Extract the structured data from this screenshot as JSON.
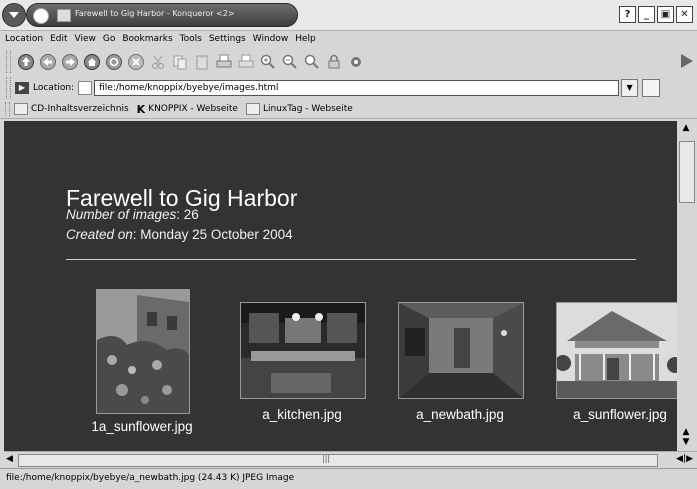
{
  "window": {
    "title": "Farewell to Gig Harbor - Konqueror <2>",
    "buttons": [
      "?",
      "_",
      "▣",
      "✕"
    ]
  },
  "menubar": [
    "Location",
    "Edit",
    "View",
    "Go",
    "Bookmarks",
    "Tools",
    "Settings",
    "Window",
    "Help"
  ],
  "toolbar": {
    "icons": [
      "up-icon",
      "back-icon",
      "forward-icon",
      "home-icon",
      "reload-icon",
      "stop-icon",
      "cut-icon",
      "copy-icon",
      "paste-icon",
      "print-icon",
      "print-frame-icon",
      "zoom-in-icon",
      "zoom-out-icon",
      "find-icon",
      "security-icon",
      "konqueror-icon"
    ]
  },
  "location": {
    "label": "Location:",
    "value": "file:/home/knoppix/byebye/images.html"
  },
  "bookmarks": [
    {
      "label": "CD-Inhaltsverzeichnis",
      "icon": "page-icon"
    },
    {
      "label": "KNOPPIX - Webseite",
      "icon": "knoppix-icon"
    },
    {
      "label": "LinuxTag - Webseite",
      "icon": "page-icon"
    }
  ],
  "page": {
    "title": "Farewell to Gig Harbor",
    "num_images_label": "Number of images",
    "num_images_value": ": 26",
    "created_label": "Created on",
    "created_value": ": Monday 25 October 2004",
    "thumbnails": [
      {
        "caption": "1a_sunflower.jpg",
        "subject": "sunflower-garden"
      },
      {
        "caption": "a_kitchen.jpg",
        "subject": "kitchen"
      },
      {
        "caption": "a_newbath.jpg",
        "subject": "bathroom"
      },
      {
        "caption": "a_sunflower.jpg",
        "subject": "house-porch"
      }
    ]
  },
  "statusbar": {
    "text": "file:/home/knoppix/byebye/a_newbath.jpg (24.43 K)  JPEG Image"
  },
  "colors": {
    "page_background": "#333333",
    "chrome": "#d6d6d6"
  }
}
